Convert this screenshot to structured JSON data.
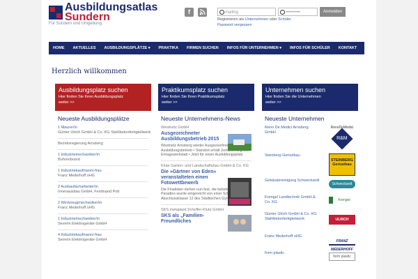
{
  "header": {
    "logo_line1": "Ausbildungsatlas",
    "logo_line2": "Sundern",
    "tagline": "Für Sundern und Umgebung",
    "social": [
      "f",
      "rss"
    ]
  },
  "login": {
    "user_placeholder": "mailing",
    "password_placeholder": "••••••••••",
    "submit_label": "Anmelden",
    "register_prefix": "Registrieren als",
    "register_companies": "Unternehmen",
    "register_or": "oder",
    "register_students": "Schüler",
    "forgot_password": "Passwort vergessen"
  },
  "nav": {
    "items": [
      "HOME",
      "AKTUELLES",
      "AUSBILDUNGSPLÄTZE ▾",
      "PRAKTIKA",
      "FIRMEN SUCHEN",
      "INFOS FÜR UNTERNEHMEN ▾",
      "INFOS FÜR SCHÜLER",
      "KONTAKT"
    ]
  },
  "welcome": "Herzlich willkommen",
  "banners": [
    {
      "title": "Ausbildungsplatz suchen",
      "sub": "Hier finden Sie Ihren Ausbildungsplatz",
      "more": "weiter >>",
      "color": "#b22222"
    },
    {
      "title": "Praktikumsplatz suchen",
      "sub": "Hier finden Sie Ihren Praktikumsplatz",
      "more": "weiter >>",
      "color": "#1a2a6c"
    },
    {
      "title": "Unternehmen suchen",
      "sub": "Hier finden Sie die Unternehmen",
      "more": "weiter >>",
      "color": "#1a2a6c"
    }
  ],
  "jobs": {
    "heading": "Neueste Ausbildungsplätze",
    "items": [
      {
        "title": "1 Maurer/in",
        "company": "Günter Ulrich GmbH & Co. KG Stahlbetonfertigteilwerk"
      },
      {
        "title": "",
        "company": "Bezirksregierung Arnsberg"
      },
      {
        "title": "1 Industriemechaniker/in",
        "company": "Buhrenbrand"
      },
      {
        "title": "1 Industriekaufmann/-frau",
        "company": "Franz Mederhoff oHG"
      },
      {
        "title": "2 Ausbaufacharbeiter/in",
        "company": "Innenausbau GmbH, Ferdinand Pott"
      },
      {
        "title": "2 Werkzeugmechaniker/in",
        "company": "Franz Mederhoff oHG"
      },
      {
        "title": "1 Industriemechaniker/in",
        "company": "Severin Elektrogeräte GmbH"
      },
      {
        "title": "4 Industriekaufmann/-frau",
        "company": "Severin Elektrogeräte GmbH"
      }
    ]
  },
  "news": {
    "heading": "Neueste Unternehmens-News",
    "items": [
      {
        "source": "Westnetz GmbH",
        "title": "Ausgezeichneter Ausbildungsbetrieb 2015",
        "text": "Westnetz Arnsberg wieder Ausgezeichneter Ausbildungsbetrieb • Standort erhält Zertifizierung von Ertragswerkstatt • Jetzt für einen Ausbildungsplatz"
      },
      {
        "source": "Klute Garten- und Landschaftsbau GmbH & Co. KG",
        "title": "Die »Gärtner von Eden« veranstalteten einen Fotowettbewerb",
        "text": "Die Finalisten stehen nun fest, die beliebteste Outdoor-Paradies wurde eingereicht von einer Schülerin der Abschlussklasse 12 des Städtischen Gymnasiu"
      },
      {
        "source": "SKS metaplast Scheffer-Klute GmbH",
        "title": "SKS als „Familien-Freundliches",
        "text": ""
      }
    ]
  },
  "companies": {
    "heading": "Neueste Unternehmen",
    "items": [
      {
        "name": "Reno De Medici Arnsberg GmbH",
        "logo": "R&M"
      },
      {
        "name": "Steinberg Gerüstbau",
        "logo": "STEINBERG Gerüstbau"
      },
      {
        "name": "Gebäudereinigung Schweckardt",
        "logo": "Schweckardt"
      },
      {
        "name": "Krengel Landtechnik GmbH & Co. KG",
        "logo": "Krengel"
      },
      {
        "name": "Günter Ulrich GmbH & Co. KG Stahlbetonfertigteilwerk",
        "logo": "ULRICH"
      },
      {
        "name": "Franz Mederhoff oHG",
        "logo": "FRANZ MEDERHOFF"
      },
      {
        "name": "form plastic",
        "logo": "form plastic"
      }
    ]
  },
  "colors": {
    "brand_blue": "#1a2a6c",
    "brand_red": "#b22222"
  }
}
